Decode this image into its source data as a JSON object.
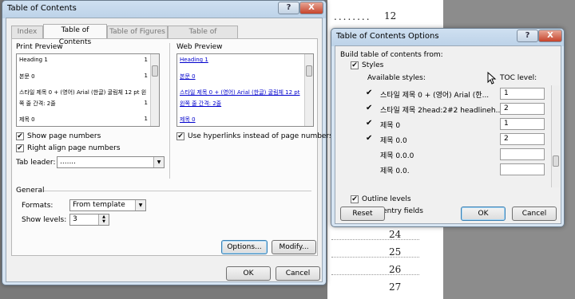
{
  "document": {
    "dots": "........",
    "page_numbers": [
      "12",
      "24",
      "25",
      "26",
      "27"
    ]
  },
  "toc_dialog": {
    "title": "Table of Contents",
    "help_glyph": "?",
    "close_glyph": "X",
    "tabs": [
      "Index",
      "Table of Contents",
      "Table of Figures",
      "Table of Authorities"
    ],
    "print_preview_label": "Print Preview",
    "print_preview_lines": [
      {
        "text": "Heading 1",
        "page": "1"
      },
      {
        "text": "본문 0",
        "page": "1"
      },
      {
        "text": "스타일 제목 0 + (영어) Arial (한글) 굴림체 12 pt 왼",
        "page": ""
      },
      {
        "text": "쪽 줄 간격: 2줄",
        "page": "1"
      },
      {
        "text": "제목 0",
        "page": "1"
      }
    ],
    "web_preview_label": "Web Preview",
    "web_preview_lines": [
      "Heading 1",
      "본문 0",
      "스타일 제목 0 + (영어) Arial (한글) 굴림체 12 pt",
      "왼쪽 줄 간격: 2줄",
      "제목 0"
    ],
    "show_page_numbers": "Show page numbers",
    "right_align": "Right align page numbers",
    "tab_leader_label": "Tab leader:",
    "tab_leader_value": ".......",
    "use_hyperlinks": "Use hyperlinks instead of page numbers",
    "general_label": "General",
    "formats_label": "Formats:",
    "formats_value": "From template",
    "show_levels_label": "Show levels:",
    "show_levels_value": "3",
    "options_button": "Options...",
    "modify_button": "Modify...",
    "ok_button": "OK",
    "cancel_button": "Cancel"
  },
  "options_dialog": {
    "title": "Table of Contents Options",
    "help_glyph": "?",
    "close_glyph": "X",
    "build_label": "Build table of contents from:",
    "styles_label": "Styles",
    "available_styles_label": "Available styles:",
    "toc_level_label": "TOC level:",
    "styles": [
      {
        "checked": "✔",
        "name": "스타일 제목 0 + (영어) Arial (한...",
        "level": "1"
      },
      {
        "checked": "✔",
        "name": "스타일 제목 2head:2#2 headlineh...",
        "level": "2"
      },
      {
        "checked": "✔",
        "name": "제목 0",
        "level": "1"
      },
      {
        "checked": "✔",
        "name": "제목 0.0",
        "level": "2"
      },
      {
        "checked": "",
        "name": "제목 0.0.0",
        "level": ""
      },
      {
        "checked": "",
        "name": "제목 0.0.",
        "level": ""
      }
    ],
    "outline_levels": "Outline levels",
    "table_entry_fields": "Table entry fields",
    "reset_button": "Reset",
    "ok_button": "OK",
    "cancel_button": "Cancel"
  }
}
